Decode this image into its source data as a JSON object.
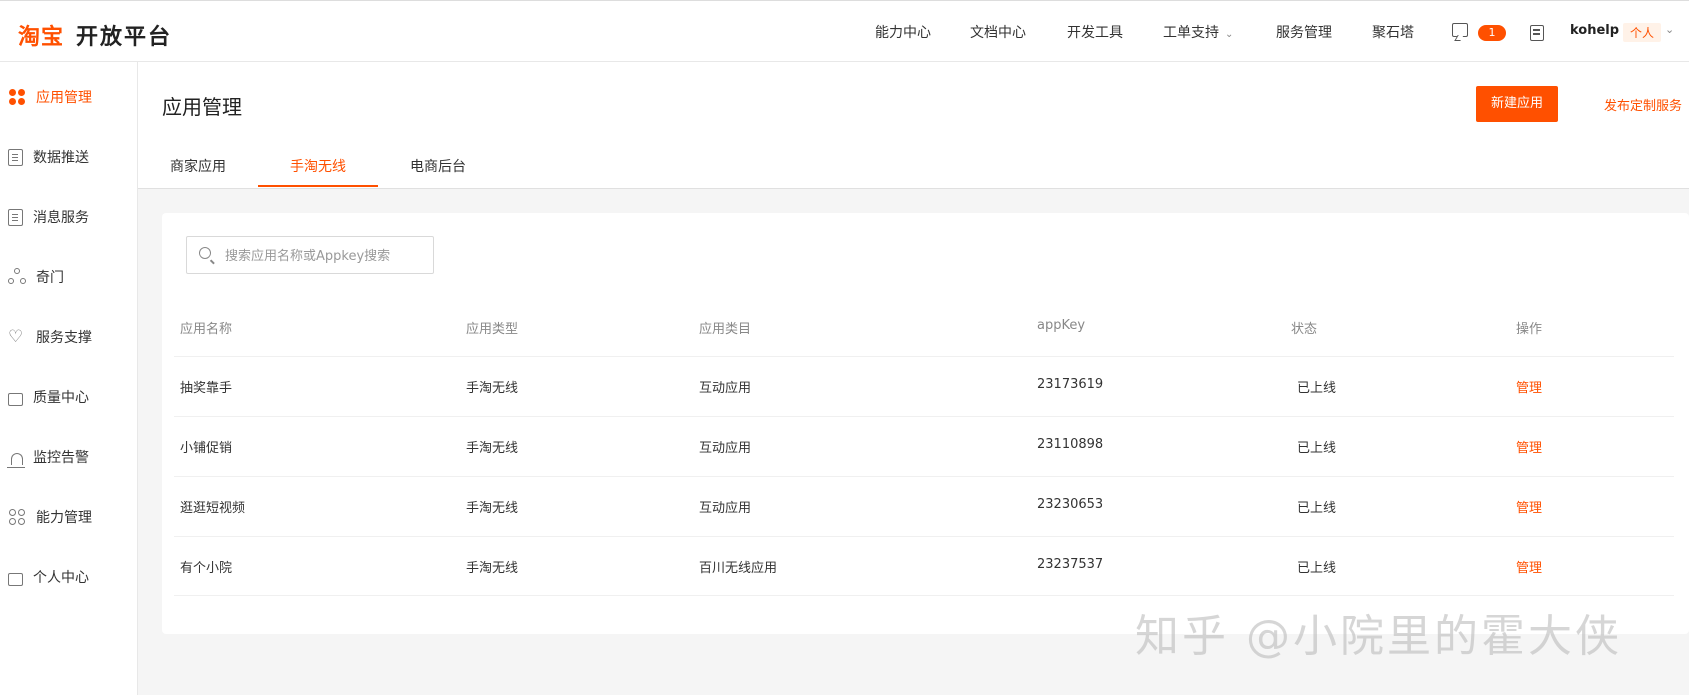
{
  "header": {
    "logo_brand": "淘宝",
    "logo_title": "开放平台",
    "nav": [
      {
        "label": "能力中心"
      },
      {
        "label": "文档中心"
      },
      {
        "label": "开发工具"
      },
      {
        "label": "工单支持"
      },
      {
        "label": "服务管理"
      },
      {
        "label": "聚石塔"
      }
    ],
    "message_badge": "1",
    "username": "kohelp",
    "role": "个人"
  },
  "sidebar": {
    "items": [
      {
        "label": "应用管理",
        "icon": "app-grid-icon",
        "active": true
      },
      {
        "label": "数据推送",
        "icon": "document-icon"
      },
      {
        "label": "消息服务",
        "icon": "document-icon"
      },
      {
        "label": "奇门",
        "icon": "nodes-icon"
      },
      {
        "label": "服务支撑",
        "icon": "heart-icon"
      },
      {
        "label": "质量中心",
        "icon": "quality-icon"
      },
      {
        "label": "监控告警",
        "icon": "alarm-icon"
      },
      {
        "label": "能力管理",
        "icon": "capability-icon"
      },
      {
        "label": "个人中心",
        "icon": "person-icon"
      }
    ]
  },
  "main": {
    "title": "应用管理",
    "new_app_button": "新建应用",
    "publish_link": "发布定制服务",
    "tabs": [
      {
        "label": "商家应用"
      },
      {
        "label": "手淘无线",
        "active": true
      },
      {
        "label": "电商后台"
      }
    ],
    "search": {
      "placeholder": "搜索应用名称或Appkey搜索",
      "value": ""
    },
    "table": {
      "columns": [
        "应用名称",
        "应用类型",
        "应用类目",
        "appKey",
        "状态",
        "操作"
      ],
      "rows": [
        [
          "抽奖靠手",
          "手淘无线",
          "互动应用",
          "23173619",
          "已上线",
          "管理"
        ],
        [
          "小铺促销",
          "手淘无线",
          "互动应用",
          "23110898",
          "已上线",
          "管理"
        ],
        [
          "逛逛短视频",
          "手淘无线",
          "互动应用",
          "23230653",
          "已上线",
          "管理"
        ],
        [
          "有个小院",
          "手淘无线",
          "百川无线应用",
          "23237537",
          "已上线",
          "管理"
        ]
      ]
    }
  },
  "watermark": "知乎 @小院里的霍大侠",
  "colors": {
    "accent": "#ff5000",
    "background": "#f5f5f5"
  }
}
